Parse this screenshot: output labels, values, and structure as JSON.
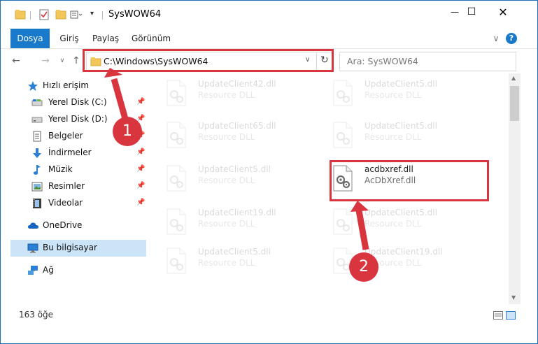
{
  "window": {
    "title": "SysWOW64",
    "min_glyph": "—",
    "max_glyph": "☐",
    "close_glyph": "✕"
  },
  "ribbon": {
    "tabs": [
      {
        "label": "Dosya",
        "active": true
      },
      {
        "label": "Giriş"
      },
      {
        "label": "Paylaş"
      },
      {
        "label": "Görünüm"
      }
    ],
    "expand_glyph": "∨",
    "help_glyph": "?"
  },
  "navigation": {
    "back_glyph": "←",
    "forward_glyph": "→",
    "recent_glyph": "∨",
    "up_glyph": "↑"
  },
  "address": {
    "path": "C:\\Windows\\SysWOW64",
    "dropdown_glyph": "∨",
    "refresh_glyph": "↻"
  },
  "search": {
    "placeholder": "Ara: SysWOW64"
  },
  "sidebar": {
    "items": [
      {
        "label": "Hızlı erişim",
        "icon": "star-icon",
        "pinned": false
      },
      {
        "label": "Yerel Disk (C:)",
        "icon": "drive-icon",
        "pinned": true
      },
      {
        "label": "Yerel Disk (D:)",
        "icon": "drive-icon",
        "pinned": true
      },
      {
        "label": "Belgeler",
        "icon": "documents-icon",
        "pinned": true
      },
      {
        "label": "İndirmeler",
        "icon": "download-icon",
        "pinned": true
      },
      {
        "label": "Müzik",
        "icon": "music-icon",
        "pinned": true
      },
      {
        "label": "Resimler",
        "icon": "pictures-icon",
        "pinned": true
      },
      {
        "label": "Videolar",
        "icon": "video-icon",
        "pinned": true
      },
      {
        "label": "OneDrive",
        "icon": "cloud-icon",
        "pinned": false
      },
      {
        "label": "Bu bilgisayar",
        "icon": "computer-icon",
        "pinned": false,
        "selected": true
      },
      {
        "label": "Ağ",
        "icon": "network-icon",
        "pinned": false
      }
    ],
    "pin_glyph": "📌"
  },
  "files": [
    {
      "name": "UpdateClient42.dll",
      "type": "Resource DLL",
      "faded": true
    },
    {
      "name": "UpdateClient5.dll",
      "type": "Resource DLL",
      "faded": true
    },
    {
      "name": "UpdateClient65.dll",
      "type": "Resource DLL",
      "faded": true
    },
    {
      "name": "UpdateClient5.dll",
      "type": "Resource DLL",
      "faded": true
    },
    {
      "name": "UpdateClient5.dll",
      "type": "Resource DLL",
      "faded": true
    },
    {
      "name": "acdbxref.dll",
      "type": "AcDbXref.dll",
      "faded": false
    },
    {
      "name": "UpdateClient19.dll",
      "type": "Resource DLL",
      "faded": true
    },
    {
      "name": "UpdateClient5.dll",
      "type": "Resource DLL",
      "faded": true
    },
    {
      "name": "UpdateClient5.dll",
      "type": "Resource DLL",
      "faded": true
    },
    {
      "name": "UpdateClient19.dll",
      "type": "Resource DLL",
      "faded": true
    }
  ],
  "status": {
    "count": "163 öğe"
  },
  "annotations": {
    "step1": "1",
    "step2": "2",
    "color": "#d9353f"
  }
}
